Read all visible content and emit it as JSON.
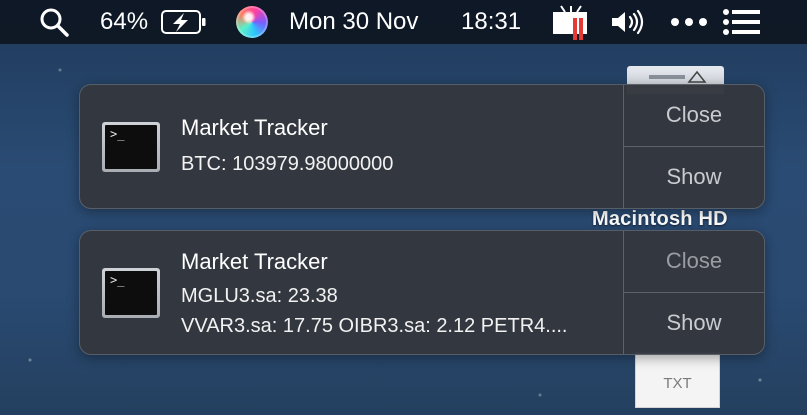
{
  "menubar": {
    "battery_percent": "64%",
    "date": "Mon 30 Nov",
    "time": "18:31"
  },
  "desktop": {
    "disk_label": "Macintosh HD",
    "file_label": "TXT"
  },
  "notifications": [
    {
      "app": "Market Tracker",
      "lines": [
        "BTC: 103979.98000000"
      ],
      "close_label": "Close",
      "show_label": "Show"
    },
    {
      "app": "Market Tracker",
      "lines": [
        "MGLU3.sa: 23.38",
        "VVAR3.sa: 17.75 OIBR3.sa: 2.12 PETR4...."
      ],
      "close_label": "Close",
      "show_label": "Show"
    }
  ],
  "icons": {
    "search": "search-icon",
    "battery": "battery-charging-icon",
    "siri": "siri-icon",
    "display": "display-mirroring-icon",
    "volume": "volume-icon",
    "more": "more-dots-icon",
    "notification_center": "notification-center-icon",
    "app": "terminal-icon"
  },
  "colors": {
    "menubar_bg": "#0e1622",
    "notification_bg": "#34373e",
    "button_text": "#c9cbcf",
    "muted_button_text": "#9a9da3",
    "display_icon_accent": "#e53935"
  }
}
